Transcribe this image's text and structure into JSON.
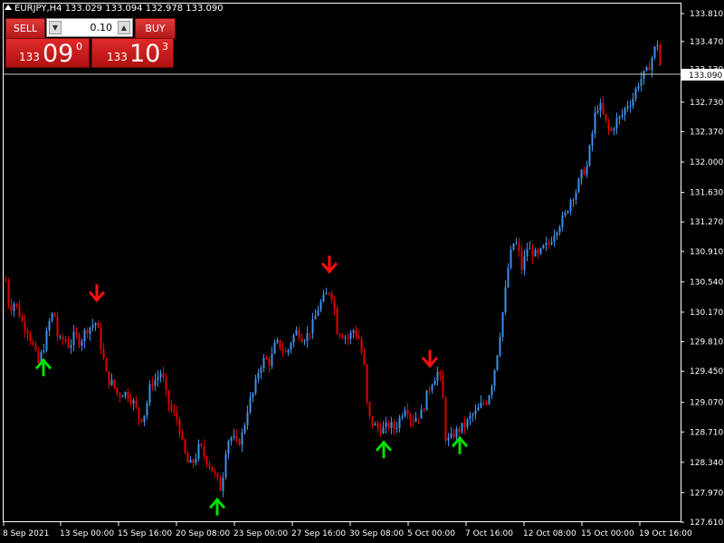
{
  "window": {
    "title": "EURJPY,H4 133.029 133.094 132.978 133.090"
  },
  "trade_panel": {
    "sell_label": "SELL",
    "buy_label": "BUY",
    "lot": "0.10",
    "sell_price_prefix": "133",
    "sell_price_big": "09",
    "sell_price_sup": "0",
    "buy_price_prefix": "133",
    "buy_price_big": "10",
    "buy_price_sup": "3"
  },
  "colors": {
    "background": "#000000",
    "bull": "#3f8fe8",
    "bear": "#e00000",
    "arrow_up": "#00e000",
    "arrow_down": "#ff1010",
    "axis": "#ffffff"
  },
  "chart_data": {
    "type": "candlestick",
    "symbol": "EURJPY",
    "timeframe": "H4",
    "current_price": "133.090",
    "y_ticks": [
      "133.810",
      "133.470",
      "133.130",
      "132.730",
      "132.370",
      "132.000",
      "131.630",
      "131.270",
      "130.910",
      "130.540",
      "130.170",
      "129.810",
      "129.450",
      "129.070",
      "128.710",
      "128.340",
      "127.970",
      "127.610"
    ],
    "x_ticks": [
      "8 Sep 2021",
      "13 Sep 00:00",
      "15 Sep 16:00",
      "20 Sep 08:00",
      "23 Sep 00:00",
      "27 Sep 16:00",
      "30 Sep 08:00",
      "5 Oct 00:00",
      "7 Oct 16:00",
      "12 Oct 08:00",
      "15 Oct 00:00",
      "19 Oct 16:00"
    ],
    "ylim": [
      127.61,
      133.81
    ],
    "close_path": [
      [
        0,
        130.55
      ],
      [
        4,
        130.2
      ],
      [
        10,
        130.3
      ],
      [
        18,
        130.05
      ],
      [
        24,
        129.95
      ],
      [
        30,
        129.75
      ],
      [
        36,
        129.55
      ],
      [
        42,
        129.75
      ],
      [
        48,
        130.05
      ],
      [
        53,
        130.2
      ],
      [
        58,
        129.8
      ],
      [
        64,
        129.85
      ],
      [
        70,
        129.75
      ],
      [
        76,
        129.9
      ],
      [
        82,
        129.8
      ],
      [
        88,
        129.95
      ],
      [
        94,
        130.0
      ],
      [
        100,
        130.05
      ],
      [
        106,
        129.7
      ],
      [
        112,
        129.35
      ],
      [
        118,
        129.3
      ],
      [
        124,
        129.15
      ],
      [
        130,
        129.2
      ],
      [
        136,
        129.15
      ],
      [
        142,
        129.05
      ],
      [
        148,
        128.85
      ],
      [
        154,
        128.95
      ],
      [
        160,
        129.3
      ],
      [
        166,
        129.35
      ],
      [
        172,
        129.45
      ],
      [
        178,
        129.1
      ],
      [
        184,
        128.95
      ],
      [
        190,
        128.85
      ],
      [
        196,
        128.5
      ],
      [
        202,
        128.3
      ],
      [
        208,
        128.35
      ],
      [
        214,
        128.55
      ],
      [
        220,
        128.4
      ],
      [
        226,
        128.3
      ],
      [
        232,
        128.15
      ],
      [
        238,
        128.0
      ],
      [
        244,
        128.6
      ],
      [
        250,
        128.65
      ],
      [
        256,
        128.55
      ],
      [
        262,
        128.7
      ],
      [
        268,
        129.05
      ],
      [
        274,
        129.2
      ],
      [
        280,
        129.5
      ],
      [
        286,
        129.6
      ],
      [
        292,
        129.55
      ],
      [
        298,
        129.8
      ],
      [
        304,
        129.75
      ],
      [
        310,
        129.65
      ],
      [
        316,
        129.85
      ],
      [
        322,
        129.95
      ],
      [
        328,
        129.85
      ],
      [
        334,
        129.9
      ],
      [
        340,
        130.05
      ],
      [
        346,
        130.25
      ],
      [
        352,
        130.35
      ],
      [
        358,
        130.45
      ],
      [
        362,
        130.3
      ],
      [
        366,
        129.95
      ],
      [
        372,
        129.9
      ],
      [
        378,
        129.85
      ],
      [
        384,
        129.95
      ],
      [
        390,
        129.85
      ],
      [
        396,
        129.5
      ],
      [
        400,
        128.9
      ],
      [
        406,
        128.8
      ],
      [
        412,
        128.75
      ],
      [
        418,
        128.75
      ],
      [
        424,
        128.8
      ],
      [
        430,
        128.75
      ],
      [
        436,
        128.9
      ],
      [
        442,
        129.05
      ],
      [
        448,
        128.85
      ],
      [
        454,
        128.9
      ],
      [
        460,
        128.95
      ],
      [
        466,
        129.2
      ],
      [
        472,
        129.35
      ],
      [
        478,
        129.45
      ],
      [
        482,
        129.25
      ],
      [
        486,
        128.65
      ],
      [
        490,
        128.6
      ],
      [
        496,
        128.7
      ],
      [
        502,
        128.75
      ],
      [
        508,
        128.8
      ],
      [
        514,
        128.9
      ],
      [
        520,
        128.95
      ],
      [
        526,
        129.05
      ],
      [
        532,
        129.1
      ],
      [
        538,
        129.35
      ],
      [
        544,
        129.75
      ],
      [
        550,
        130.25
      ],
      [
        556,
        130.8
      ],
      [
        562,
        131.05
      ],
      [
        566,
        130.95
      ],
      [
        570,
        130.7
      ],
      [
        576,
        130.95
      ],
      [
        582,
        130.9
      ],
      [
        588,
        130.85
      ],
      [
        594,
        130.95
      ],
      [
        600,
        131.0
      ],
      [
        606,
        131.15
      ],
      [
        612,
        131.25
      ],
      [
        618,
        131.35
      ],
      [
        624,
        131.55
      ],
      [
        630,
        131.65
      ],
      [
        636,
        131.85
      ],
      [
        642,
        131.95
      ],
      [
        648,
        132.35
      ],
      [
        652,
        132.65
      ],
      [
        656,
        132.7
      ],
      [
        662,
        132.5
      ],
      [
        668,
        132.35
      ],
      [
        674,
        132.5
      ],
      [
        680,
        132.55
      ],
      [
        686,
        132.7
      ],
      [
        692,
        132.75
      ],
      [
        698,
        132.95
      ],
      [
        704,
        133.05
      ],
      [
        708,
        133.1
      ],
      [
        712,
        133.2
      ],
      [
        716,
        133.35
      ],
      [
        720,
        133.45
      ],
      [
        724,
        133.09
      ]
    ],
    "arrows": [
      {
        "dir": "up",
        "t": 42,
        "price": 129.65
      },
      {
        "dir": "down",
        "t": 101,
        "price": 130.25
      },
      {
        "dir": "up",
        "t": 234,
        "price": 127.95
      },
      {
        "dir": "down",
        "t": 358,
        "price": 130.6
      },
      {
        "dir": "up",
        "t": 418,
        "price": 128.65
      },
      {
        "dir": "down",
        "t": 469,
        "price": 129.45
      },
      {
        "dir": "up",
        "t": 502,
        "price": 128.7
      }
    ]
  }
}
